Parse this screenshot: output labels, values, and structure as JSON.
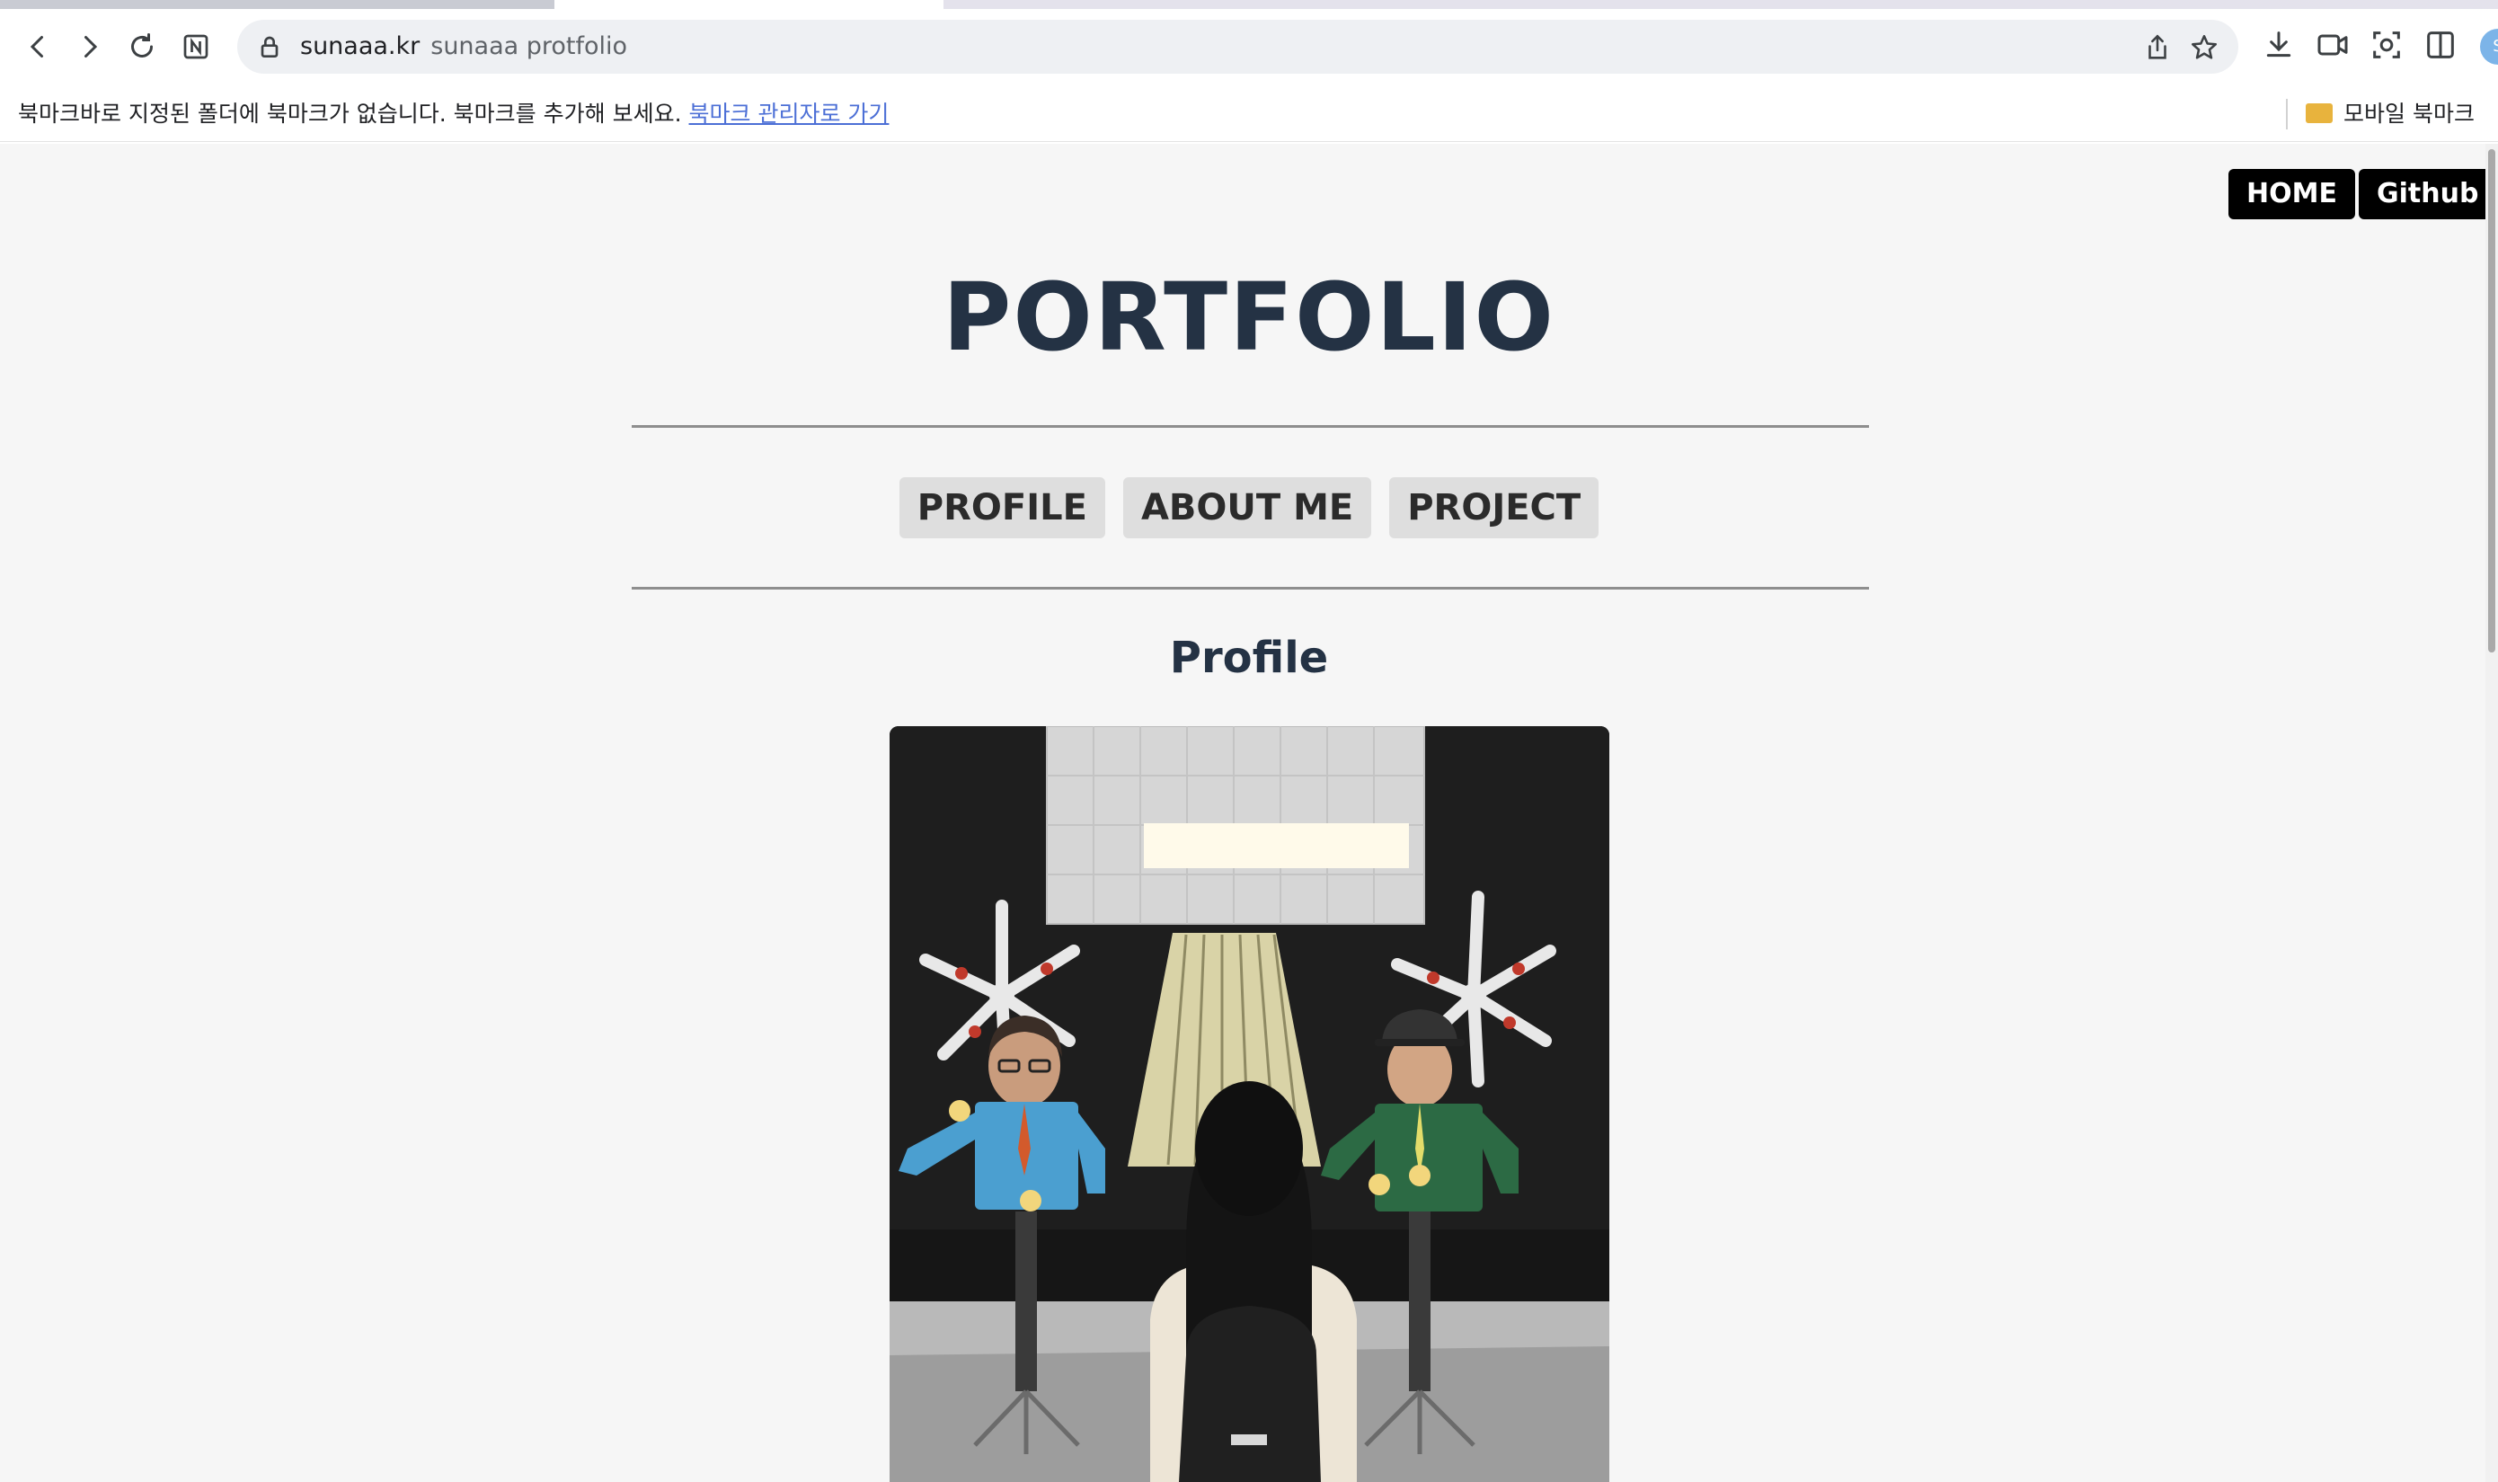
{
  "browser": {
    "url_host": "sunaaa.kr",
    "page_title": "sunaaa protfolio",
    "avatar_initial": "S"
  },
  "bookmarks_bar": {
    "empty_message": "북마크바로 지정된 폴더에 북마크가 없습니다. 북마크를 추가해 보세요.",
    "manager_link": "북마크 관리자로 가기",
    "mobile_bookmarks": "모바일 북마크"
  },
  "page": {
    "top_buttons": {
      "home": "HOME",
      "github": "Github"
    },
    "title": "PORTFOLIO",
    "menu": [
      {
        "label": "PROFILE"
      },
      {
        "label": "ABOUT ME"
      },
      {
        "label": "PROJECT"
      }
    ],
    "section_heading": "Profile",
    "profile_photo_icon": "photo-of-person-at-robot-exhibit"
  }
}
